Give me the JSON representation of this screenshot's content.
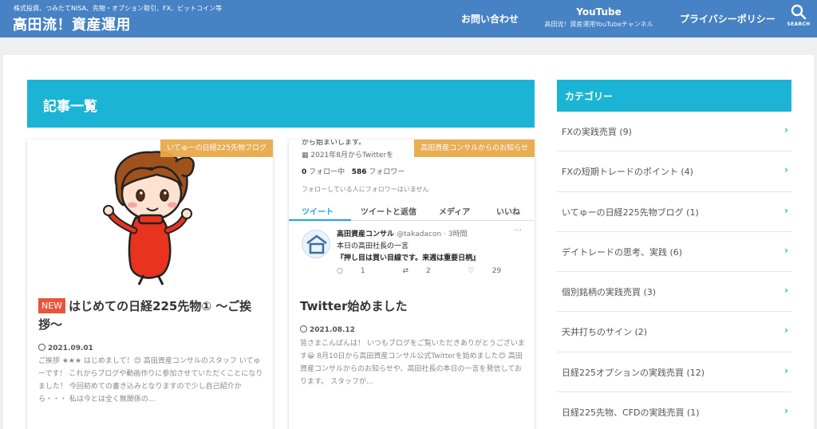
{
  "header": {
    "tagline": "株式投資、つみたてNISA、先物・オプション取引、FX、ビットコイン等",
    "site_title": "高田流！資産運用",
    "nav": {
      "contact": "お問い合わせ",
      "youtube_title": "YouTube",
      "youtube_sub": "高田流！資産運用YouTubeチャンネル",
      "privacy": "プライバシーポリシー",
      "search_label": "SEARCH"
    }
  },
  "main": {
    "archive_title": "記事一覧",
    "cards": [
      {
        "category": "いてゅーの日経225先物ブログ",
        "badge": "NEW",
        "title": "はじめての日経225先物① 〜ご挨拶〜",
        "date": "2021.09.01",
        "excerpt": "ご挨拶 ★★★ はじめまして！😊 高田資産コンサルのスタッフ いてゅーです！ これからブログや動画作りに参加させていただくことになりました！ 今回初めての書き込みとなりますので少し自己紹介から・・・ 私は今とは全く無関係の..."
      },
      {
        "category": "高田資産コンサルからのお知らせ",
        "title": "Twitter始めました",
        "date": "2021.08.12",
        "excerpt": "皆さまこんばんは！ いつもブログをご覧いただきありがとうございます😀 8月10日から高田資産コンサル公式Twitterを始めました😊 高田資産コンサルからのお知らせや、高田社長の本日の一言を発信しております。 スタッフが...",
        "twitter": {
          "cut_line": "から始まいします。",
          "joined": "2021年8月からTwitterを",
          "following_count": "0",
          "following_label": "フォロー中",
          "followers_count": "586",
          "followers_label": "フォロワー",
          "no_followers_you_know": "フォローしている人にフォロワーはいません",
          "tabs": [
            "ツイート",
            "ツイートと返信",
            "メディア",
            "いいね"
          ],
          "tweet_name": "高田資産コンサル",
          "tweet_handle": "@takadacon · 3時間",
          "tweet_line1": "本日の高田社長の一言",
          "tweet_line2": "『押し目は買い目線です。来週は重要日柄』",
          "reply_count": "1",
          "retweet_count": "2",
          "like_count": "29"
        }
      }
    ]
  },
  "sidebar": {
    "title": "カテゴリー",
    "categories": [
      "FXの実践売買 (9)",
      "FXの短期トレードのポイント (4)",
      "いてゅーの日経225先物ブログ (1)",
      "デイトレードの思考、実践 (6)",
      "個別銘柄の実践売買 (3)",
      "天井打ちのサイン (2)",
      "日経225オプションの実践売買 (12)",
      "日経225先物、CFDの実践売買 (1)"
    ]
  },
  "colors": {
    "header_bg": "#4682c4",
    "accent": "#1cb4d4",
    "category_label": "#e8a94a",
    "new_badge": "#e8553b"
  }
}
